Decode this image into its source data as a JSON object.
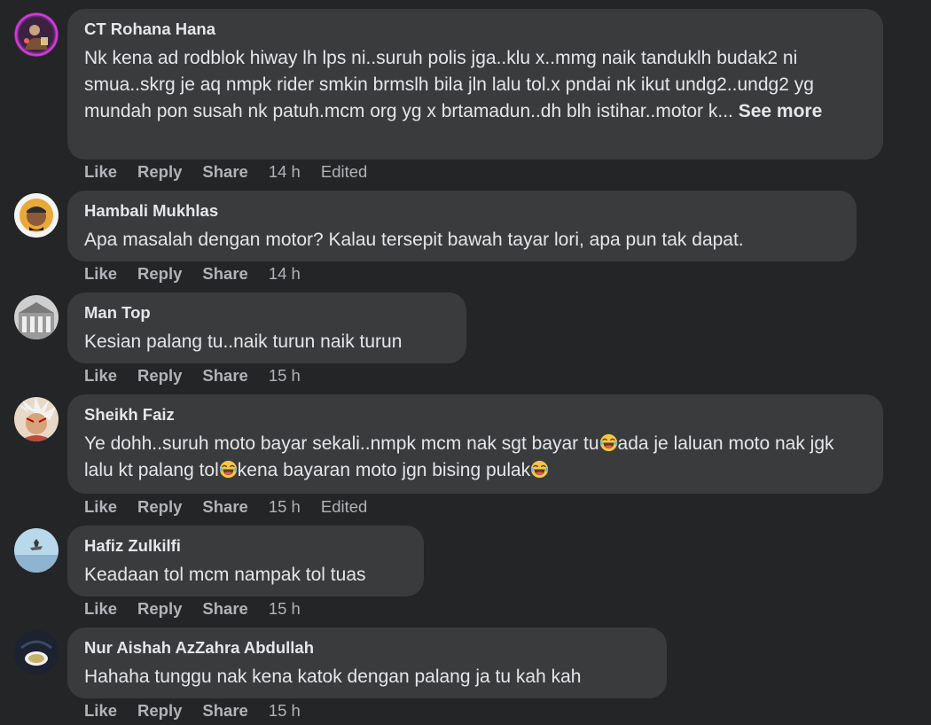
{
  "actions": {
    "like": "Like",
    "reply": "Reply",
    "share": "Share",
    "edited": "Edited"
  },
  "comments": [
    {
      "author": "CT Rohana Hana",
      "text": "Nk kena ad rodblok hiway lh lps ni..suruh polis jga..klu x..mmg naik tanduklh budak2 ni smua..skrg je aq nmpk rider smkin brmslh bila jln lalu tol.x pndai nk ikut undg2..undg2 yg mundah pon susah nk patuh.mcm org yg x brtamadun..dh blh istihar..motor k...",
      "see_more": "See more",
      "time": "14 h",
      "edited": true
    },
    {
      "author": "Hambali Mukhlas",
      "text": "Apa masalah dengan motor? Kalau tersepit bawah tayar lori, apa pun tak dapat.",
      "time": "14 h"
    },
    {
      "author": "Man Top",
      "text": "Kesian palang tu..naik turun naik turun",
      "time": "15 h"
    },
    {
      "author": "Sheikh Faiz",
      "text_parts": [
        "Ye dohh..suruh moto bayar sekali..nmpk mcm nak sgt bayar tu",
        "ada je laluan moto nak jgk lalu kt palang tol",
        "kena bayaran moto jgn bising pulak"
      ],
      "emoji": "face-with-tears-of-joy",
      "time": "15 h",
      "edited": true
    },
    {
      "author": "Hafiz Zulkilfi",
      "text": "Keadaan tol mcm nampak tol tuas",
      "time": "15 h"
    },
    {
      "author": "Nur Aishah AzZahra Abdullah",
      "text": "Hahaha tunggu nak kena katok dengan palang ja tu kah kah",
      "time": "15 h"
    }
  ],
  "colors": {
    "background": "#242526",
    "bubble": "#3a3b3c",
    "text": "#e4e6eb",
    "secondary": "#b0b3b8"
  }
}
